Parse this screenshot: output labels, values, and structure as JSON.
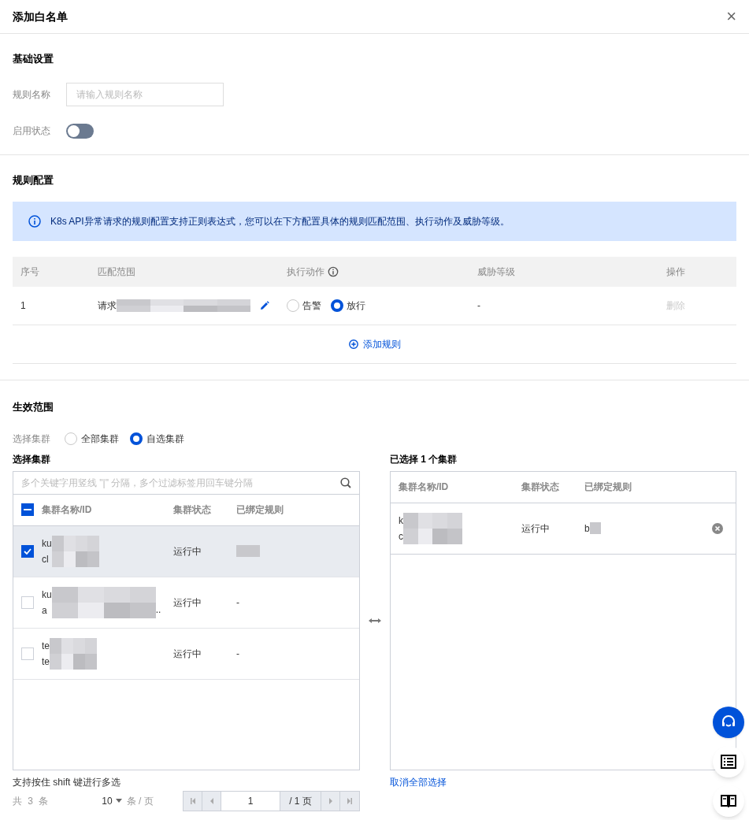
{
  "dialog": {
    "title": "添加白名单",
    "close": "×"
  },
  "basic": {
    "heading": "基础设置",
    "name_label": "规则名称",
    "name_placeholder": "请输入规则名称",
    "status_label": "启用状态",
    "enabled": false
  },
  "rules": {
    "heading": "规则配置",
    "notice": "K8s API异常请求的规则配置支持正则表达式，您可以在下方配置具体的规则匹配范围、执行动作及威胁等级。",
    "columns": [
      "序号",
      "匹配范围",
      "执行动作",
      "威胁等级",
      "操作"
    ],
    "rows": [
      {
        "index": "1",
        "scope": "请求",
        "actions": [
          {
            "label": "告警",
            "selected": false
          },
          {
            "label": "放行",
            "selected": true
          }
        ],
        "level": "-",
        "delete": "删除",
        "delete_disabled": true
      }
    ],
    "add": "添加规则"
  },
  "scope": {
    "heading": "生效范围",
    "select_label": "选择集群",
    "options": [
      {
        "label": "全部集群",
        "selected": false
      },
      {
        "label": "自选集群",
        "selected": true
      }
    ],
    "left": {
      "heading": "选择集群",
      "search_placeholder": "多个关键字用竖线 \"|\" 分隔，多个过滤标签用回车键分隔",
      "columns": [
        "集群名称/ID",
        "集群状态",
        "已绑定规则"
      ],
      "select_all_indeterminate": true,
      "rows": [
        {
          "name": "ku",
          "id": "cl",
          "status": "运行中",
          "checked": true
        },
        {
          "name": "ku",
          "id": "a",
          "id_tail": "..",
          "status": "运行中",
          "rule": "-",
          "checked": false
        },
        {
          "name": "te",
          "id": "te",
          "status": "运行中",
          "rule": "-",
          "checked": false
        }
      ],
      "hint": "支持按住 shift 键进行多选",
      "total": "共 3 条",
      "page_size": "10",
      "per_page": "条 / 页",
      "page": "1",
      "pages": "/ 1 页"
    },
    "right": {
      "heading": "已选择 1 个集群",
      "columns": [
        "集群名称/ID",
        "集群状态",
        "已绑定规则"
      ],
      "rows": [
        {
          "name": "k",
          "id": "c",
          "status": "运行中",
          "rule": "b"
        }
      ],
      "clear": "取消全部选择"
    }
  }
}
